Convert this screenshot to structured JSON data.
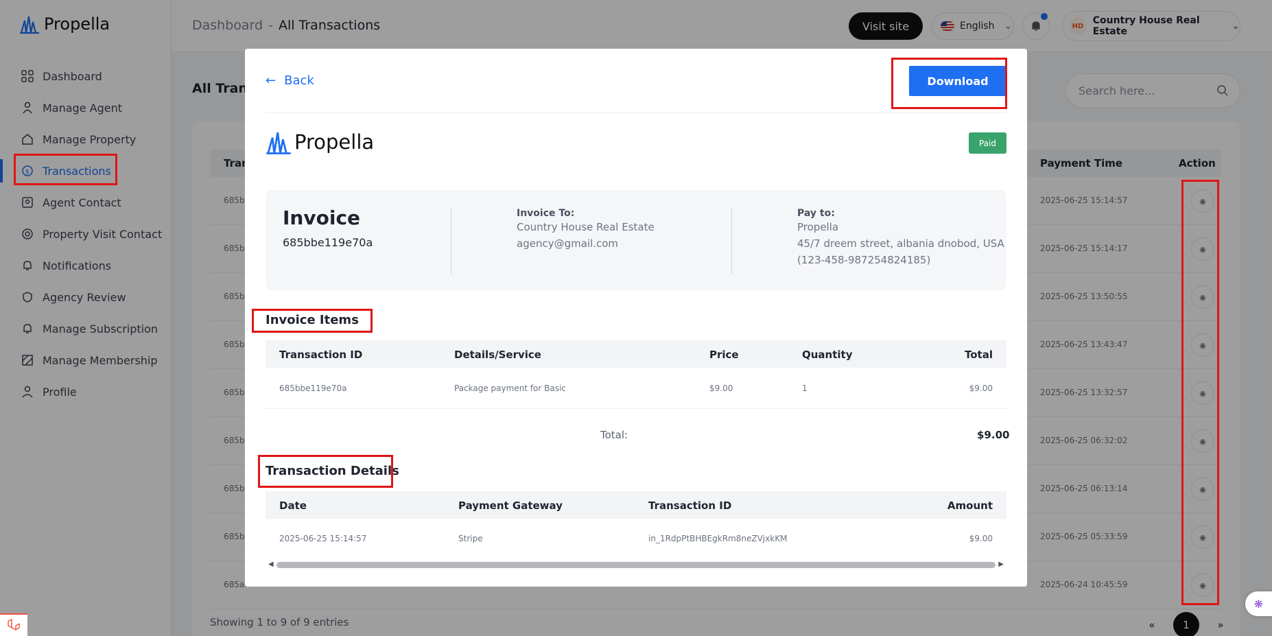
{
  "app": {
    "name": "Propella"
  },
  "sidebar": {
    "items": [
      {
        "label": "Dashboard",
        "icon": "grid-icon"
      },
      {
        "label": "Manage Agent",
        "icon": "agent-icon"
      },
      {
        "label": "Manage Property",
        "icon": "home-icon"
      },
      {
        "label": "Transactions",
        "icon": "transactions-icon",
        "active": true
      },
      {
        "label": "Agent Contact",
        "icon": "contact-icon"
      },
      {
        "label": "Property Visit Contact",
        "icon": "visit-icon"
      },
      {
        "label": "Notifications",
        "icon": "bell-icon"
      },
      {
        "label": "Agency Review",
        "icon": "review-icon"
      },
      {
        "label": "Manage Subscription",
        "icon": "subscription-icon"
      },
      {
        "label": "Manage Membership",
        "icon": "membership-icon"
      },
      {
        "label": "Profile",
        "icon": "user-icon"
      }
    ]
  },
  "header": {
    "breadcrumb_root": "Dashboard",
    "breadcrumb_sep": "-",
    "breadcrumb_current": "All Transactions",
    "visit_site": "Visit site",
    "language": "English",
    "account_name": "Country House Real Estate",
    "avatar_initials": "HD"
  },
  "page": {
    "title_partial": "All Trans",
    "search_placeholder": "Search here...",
    "columns": {
      "id": "Tran",
      "payment_time": "Payment Time",
      "action": "Action"
    },
    "rows": [
      {
        "id": "685b",
        "time": "2025-06-25 15:14:57"
      },
      {
        "id": "685b",
        "time": "2025-06-25 15:14:17"
      },
      {
        "id": "685b",
        "time": "2025-06-25 13:50:55"
      },
      {
        "id": "685b",
        "time": "2025-06-25 13:43:47"
      },
      {
        "id": "685b",
        "time": "2025-06-25 13:32:57"
      },
      {
        "id": "685b",
        "time": "2025-06-25 06:32:02"
      },
      {
        "id": "685b",
        "time": "2025-06-25 06:13:14"
      },
      {
        "id": "685b",
        "time": "2025-06-25 05:33:59"
      },
      {
        "id": "685a",
        "time": "2025-06-24 10:45:59"
      }
    ],
    "showing": "Showing 1 to 9 of 9 entries",
    "pager": {
      "prev": "«",
      "current": "1",
      "next": "»"
    }
  },
  "modal": {
    "back": "Back",
    "download": "Download",
    "brand": "Propella",
    "status": "Paid",
    "invoice_title": "Invoice",
    "invoice_id": "685bbe119e70a",
    "invoice_to_label": "Invoice To:",
    "invoice_to_name": "Country House Real Estate",
    "invoice_to_email": "agency@gmail.com",
    "pay_to_label": "Pay to:",
    "pay_to_name": "Propella",
    "pay_to_address": "45/7 dreem street, albania dnobod, USA",
    "pay_to_phone": "(123-458-987254824185)",
    "items_title": "Invoice Items",
    "items_cols": {
      "tid": "Transaction ID",
      "details": "Details/Service",
      "price": "Price",
      "qty": "Quantity",
      "total": "Total"
    },
    "item": {
      "tid": "685bbe119e70a",
      "details": "Package payment for Basic",
      "price": "$9.00",
      "qty": "1",
      "total": "$9.00"
    },
    "total_label": "Total:",
    "total_value": "$9.00",
    "details_title": "Transaction Details",
    "details_cols": {
      "date": "Date",
      "gateway": "Payment Gateway",
      "tid": "Transaction ID",
      "amount": "Amount"
    },
    "detail": {
      "date": "2025-06-25 15:14:57",
      "gateway": "Stripe",
      "tid": "in_1RdpPtBHBEgkRm8neZVjxkKM",
      "amount": "$9.00"
    }
  },
  "colors": {
    "accent": "#1f6ff2",
    "paid": "#3aa36c",
    "annotation": "#e01515"
  }
}
